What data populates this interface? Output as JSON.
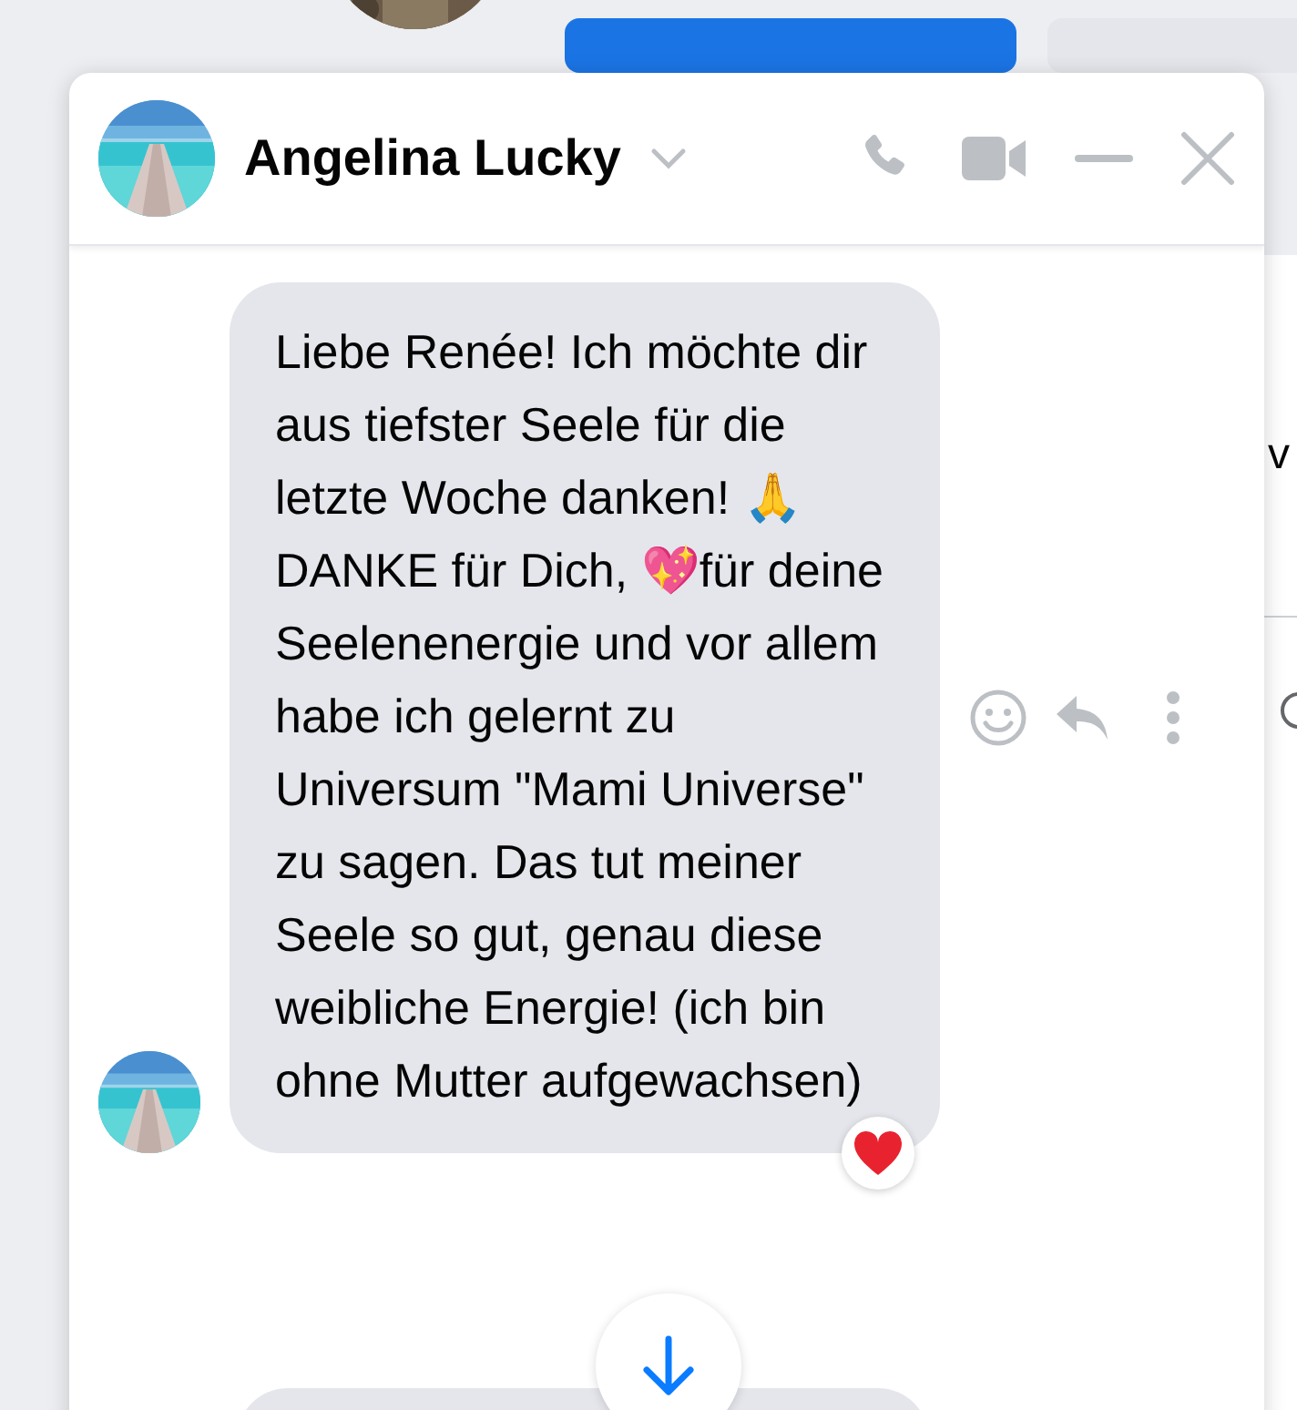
{
  "background": {
    "side_text": "v"
  },
  "chat": {
    "title": "Angelina Lucky",
    "messages": [
      {
        "text": "Liebe Renée! Ich möchte dir aus tiefster Seele für die letzte Woche danken! 🙏DANKE für Dich, 💖für deine Seelenenergie und vor allem habe ich gelernt zu Universum \"Mami Universe\" zu sagen. Das tut meiner Seele so gut, genau diese weibliche Energie! (ich bin ohne Mutter aufgewachsen)",
        "reacted": true
      }
    ]
  }
}
